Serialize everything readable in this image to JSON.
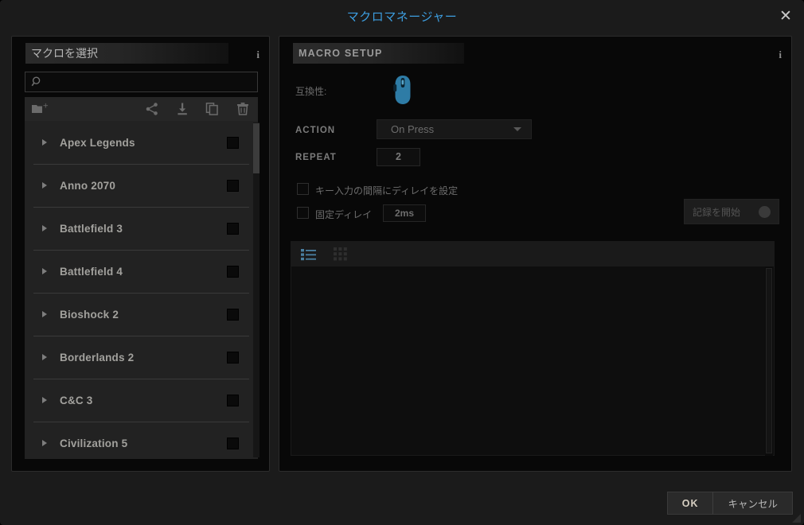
{
  "window": {
    "title": "マクロマネージャー",
    "close_label": "✕",
    "accent_color": "#3d9ee0"
  },
  "left_panel": {
    "title": "マクロを選択",
    "info_icon": "info-icon",
    "search": {
      "value": "",
      "placeholder": ""
    },
    "toolbar": [
      {
        "name": "new-folder-button",
        "icon": "folder-plus-icon"
      },
      {
        "name": "share-button",
        "icon": "share-icon"
      },
      {
        "name": "import-button",
        "icon": "download-icon"
      },
      {
        "name": "duplicate-button",
        "icon": "copy-icon"
      },
      {
        "name": "delete-button",
        "icon": "trash-icon"
      }
    ],
    "macros": [
      {
        "label": "Apex Legends"
      },
      {
        "label": "Anno 2070"
      },
      {
        "label": "Battlefield 3"
      },
      {
        "label": "Battlefield 4"
      },
      {
        "label": "Bioshock 2"
      },
      {
        "label": "Borderlands 2"
      },
      {
        "label": "C&C 3"
      },
      {
        "label": "Civilization 5"
      }
    ]
  },
  "right_panel": {
    "title": "MACRO SETUP",
    "info_icon": "info-icon",
    "compatibility_label": "互換性:",
    "compatibility_device_icon": "mouse-icon",
    "action_label": "ACTION",
    "action_value": "On Press",
    "repeat_label": "REPEAT",
    "repeat_value": "2",
    "delay_between_keys_label": "キー入力の間隔にディレイを設定",
    "fixed_delay_label": "固定ディレイ",
    "fixed_delay_value": "2ms",
    "record_button_label": "記録を開始",
    "view_list_icon": "list-view-icon",
    "view_grid_icon": "grid-view-icon",
    "view_active_color": "#4a7fa0"
  },
  "footer": {
    "ok_label": "OK",
    "cancel_label": "キャンセル"
  }
}
